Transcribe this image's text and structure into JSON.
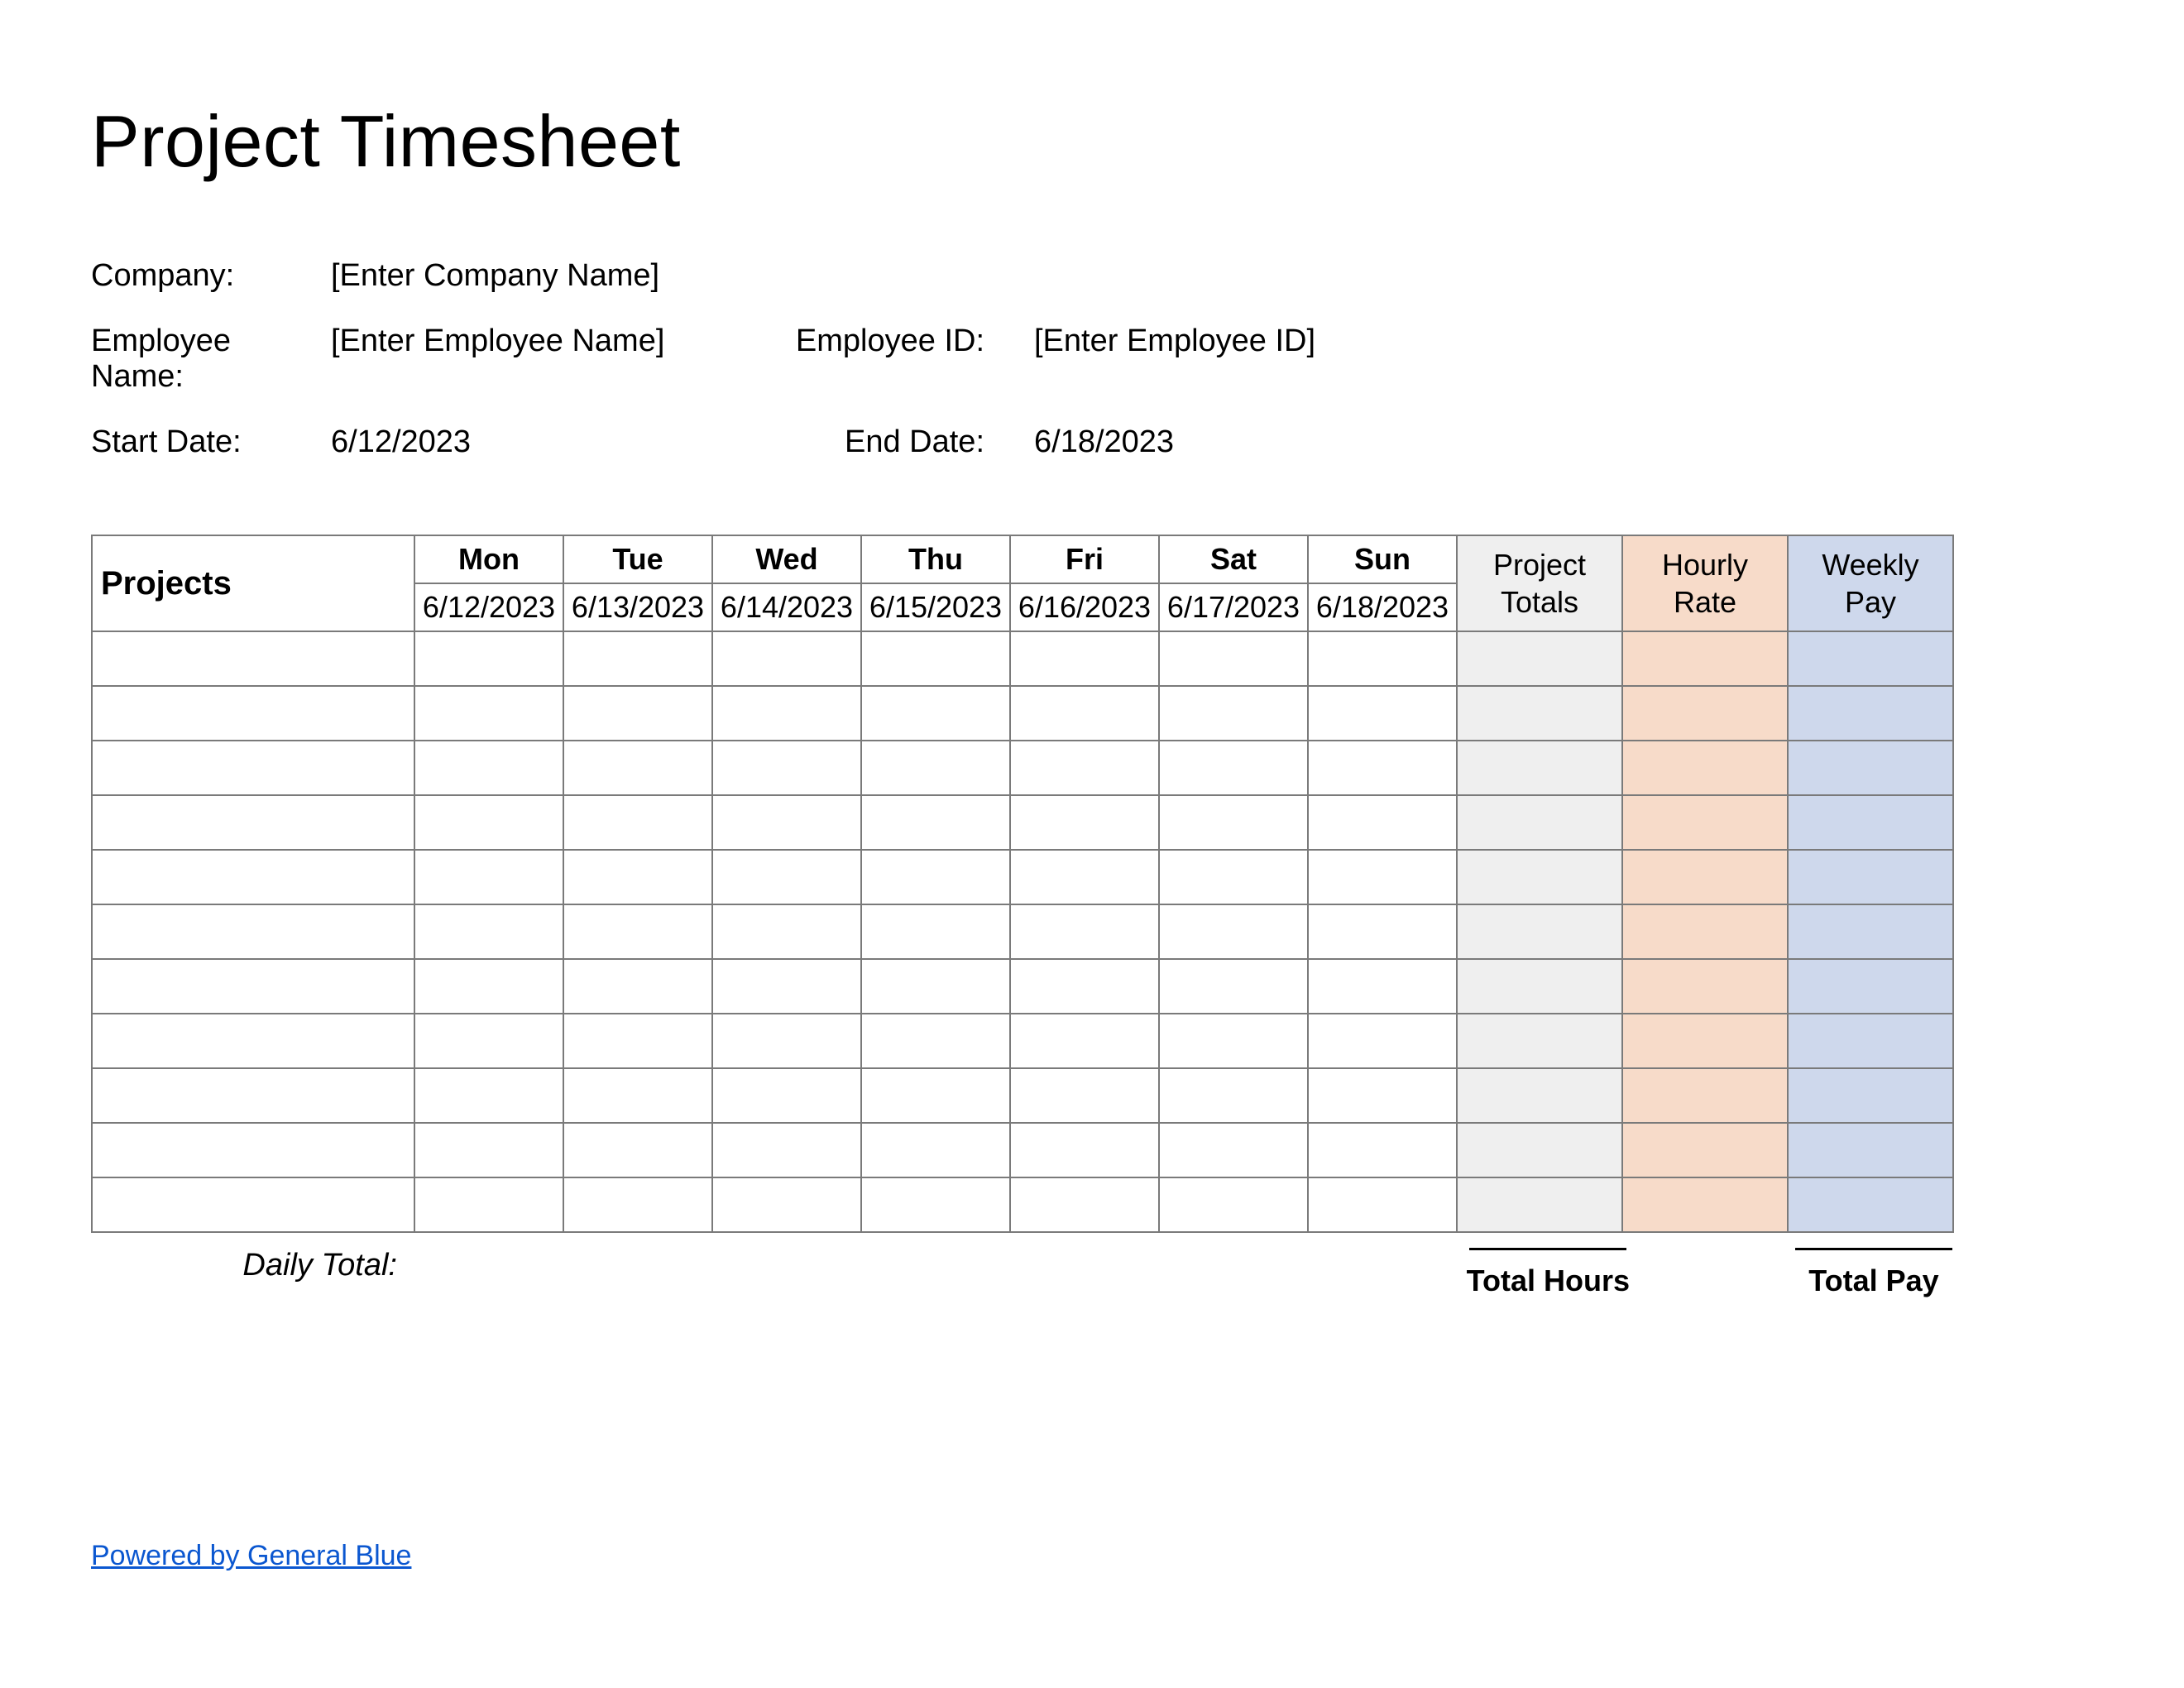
{
  "title": "Project Timesheet",
  "info": {
    "company_label": "Company:",
    "company_value": "[Enter Company Name]",
    "employee_name_label": "Employee Name:",
    "employee_name_value": "[Enter Employee Name]",
    "employee_id_label": "Employee ID:",
    "employee_id_value": "[Enter Employee ID]",
    "start_date_label": "Start Date:",
    "start_date_value": "6/12/2023",
    "end_date_label": "End Date:",
    "end_date_value": "6/18/2023"
  },
  "table": {
    "projects_header": "Projects",
    "days": [
      "Mon",
      "Tue",
      "Wed",
      "Thu",
      "Fri",
      "Sat",
      "Sun"
    ],
    "dates": [
      "6/12/2023",
      "6/13/2023",
      "6/14/2023",
      "6/15/2023",
      "6/16/2023",
      "6/17/2023",
      "6/18/2023"
    ],
    "project_totals_header": "Project Totals",
    "hourly_rate_header": "Hourly Rate",
    "weekly_pay_header": "Weekly Pay",
    "row_count": 11,
    "colors": {
      "project_totals": "#efefef",
      "hourly_rate": "#f7dbc9",
      "weekly_pay": "#ced8ec"
    }
  },
  "footer": {
    "daily_total_label": "Daily Total:",
    "total_hours_label": "Total Hours",
    "total_pay_label": "Total Pay",
    "powered_by": "Powered by General Blue"
  }
}
